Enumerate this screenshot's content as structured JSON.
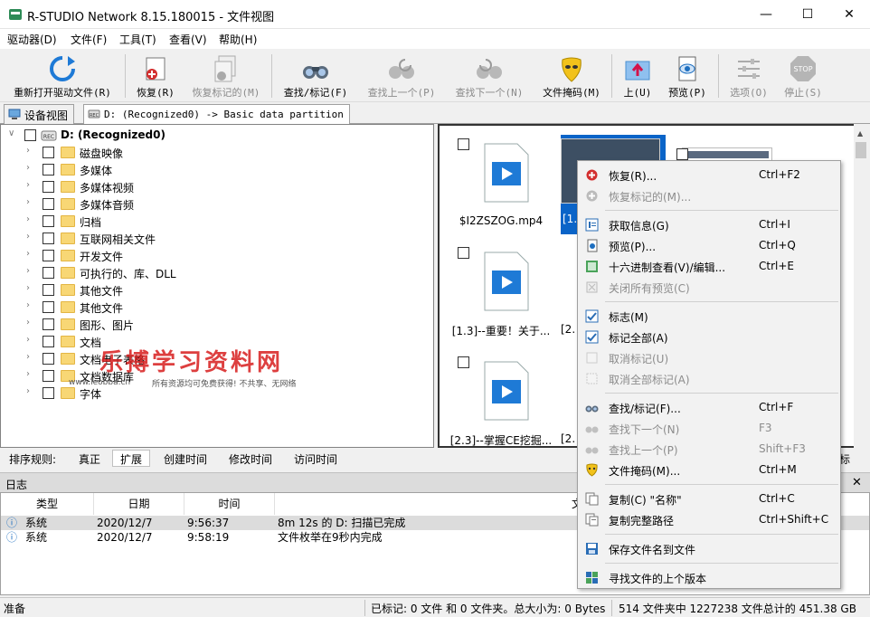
{
  "window": {
    "title": "R-STUDIO Network 8.15.180015 - 文件视图"
  },
  "menu": [
    "驱动器(D)",
    "文件(F)",
    "工具(T)",
    "查看(V)",
    "帮助(H)"
  ],
  "toolbar": [
    {
      "label": "重新打开驱动文件(R)",
      "icon": "refresh-icon",
      "enabled": true
    },
    {
      "label": "恢复(R)",
      "icon": "recover-icon",
      "enabled": true
    },
    {
      "label": "恢复标记的(M)",
      "icon": "recover-marked-icon",
      "enabled": false
    },
    {
      "label": "查找/标记(F)",
      "icon": "binoculars-icon",
      "enabled": true
    },
    {
      "label": "查找上一个(P)",
      "icon": "find-prev-icon",
      "enabled": false
    },
    {
      "label": "查找下一个(N)",
      "icon": "find-next-icon",
      "enabled": false
    },
    {
      "label": "文件掩码(M)",
      "icon": "mask-icon",
      "enabled": true
    },
    {
      "label": "上(U)",
      "icon": "up-folder-icon",
      "enabled": true
    },
    {
      "label": "预览(P)",
      "icon": "preview-icon",
      "enabled": true
    },
    {
      "label": "选项(O)",
      "icon": "options-icon",
      "enabled": false
    },
    {
      "label": "停止(S)",
      "icon": "stop-icon",
      "enabled": false
    }
  ],
  "tabs": [
    {
      "label": "设备视图"
    },
    {
      "label": "D: (Recognized0) -> Basic data partition"
    }
  ],
  "tree": {
    "root": "D: (Recognized0)",
    "folders": [
      "磁盘映像",
      "多媒体",
      "多媒体视频",
      "多媒体音频",
      "归档",
      "互联网相关文件",
      "开发文件",
      "可执行的、库、DLL",
      "其他文件",
      "其他文件",
      "图形、图片",
      "文档",
      "文档电子表格",
      "文档数据库",
      "字体"
    ]
  },
  "files": [
    {
      "name": "$I2ZSZOG.mp4"
    },
    {
      "name": "[1.3]--重要！关于..."
    },
    {
      "name": "[2.3]--掌握CE挖掘..."
    }
  ],
  "partial_files": [
    "[1.",
    "[2.",
    "[2."
  ],
  "context_menu": [
    {
      "label": "恢复(R)...",
      "shortcut": "Ctrl+F2",
      "icon": "recover-icon",
      "enabled": true
    },
    {
      "label": "恢复标记的(M)...",
      "shortcut": "",
      "icon": "recover-marked-icon",
      "enabled": false
    },
    {
      "sep": true
    },
    {
      "label": "获取信息(G)",
      "shortcut": "Ctrl+I",
      "icon": "info-icon",
      "enabled": true
    },
    {
      "label": "预览(P)...",
      "shortcut": "Ctrl+Q",
      "icon": "preview-icon",
      "enabled": true
    },
    {
      "label": "十六进制查看(V)/编辑...",
      "shortcut": "Ctrl+E",
      "icon": "hex-icon",
      "enabled": true
    },
    {
      "label": "关闭所有预览(C)",
      "shortcut": "",
      "icon": "close-preview-icon",
      "enabled": false
    },
    {
      "sep": true
    },
    {
      "label": "标志(M)",
      "shortcut": "",
      "icon": "check-icon",
      "enabled": true
    },
    {
      "label": "标记全部(A)",
      "shortcut": "",
      "icon": "check-all-icon",
      "enabled": true
    },
    {
      "label": "取消标记(U)",
      "shortcut": "",
      "icon": "uncheck-icon",
      "enabled": false
    },
    {
      "label": "取消全部标记(A)",
      "shortcut": "",
      "icon": "uncheck-all-icon",
      "enabled": false
    },
    {
      "sep": true
    },
    {
      "label": "查找/标记(F)...",
      "shortcut": "Ctrl+F",
      "icon": "binoculars-icon",
      "enabled": true
    },
    {
      "label": "查找下一个(N)",
      "shortcut": "F3",
      "icon": "find-next-icon",
      "enabled": false
    },
    {
      "label": "查找上一个(P)",
      "shortcut": "Shift+F3",
      "icon": "find-prev-icon",
      "enabled": false
    },
    {
      "label": "文件掩码(M)...",
      "shortcut": "Ctrl+M",
      "icon": "mask-icon",
      "enabled": true
    },
    {
      "sep": true
    },
    {
      "label": "复制(C) \"名称\"",
      "shortcut": "Ctrl+C",
      "icon": "copy-icon",
      "enabled": true
    },
    {
      "label": "复制完整路径",
      "shortcut": "Ctrl+Shift+C",
      "icon": "copy-path-icon",
      "enabled": true
    },
    {
      "sep": true
    },
    {
      "label": "保存文件名到文件",
      "shortcut": "",
      "icon": "save-names-icon",
      "enabled": true
    },
    {
      "sep": true
    },
    {
      "label": "寻找文件的上个版本",
      "shortcut": "",
      "icon": "versions-icon",
      "enabled": true
    }
  ],
  "sortbar": {
    "label": "排序规则:",
    "buttons": [
      "真正",
      "扩展",
      "创建时间",
      "修改时间",
      "访问时间"
    ],
    "active": "扩展",
    "right_partial": "标"
  },
  "log": {
    "title": "日志",
    "columns": [
      "类型",
      "日期",
      "时间",
      "文本"
    ],
    "rows": [
      {
        "type": "系统",
        "date": "2020/12/7",
        "time": "9:56:37",
        "text": "8m 12s 的 D: 扫描已完成"
      },
      {
        "type": "系统",
        "date": "2020/12/7",
        "time": "9:58:19",
        "text": "文件枚举在9秒内完成"
      }
    ]
  },
  "status": {
    "left": "准备",
    "marked": "已标记: 0 文件 和 0 文件夹。总大小为: 0 Bytes",
    "total": "514 文件夹中 1227238 文件总计的 451.38 GB"
  },
  "watermark": {
    "title": "乐搏学习资料网",
    "url": "www.leobba.cn",
    "text": "所有资源均可免费获得! 不共享、无网络"
  }
}
